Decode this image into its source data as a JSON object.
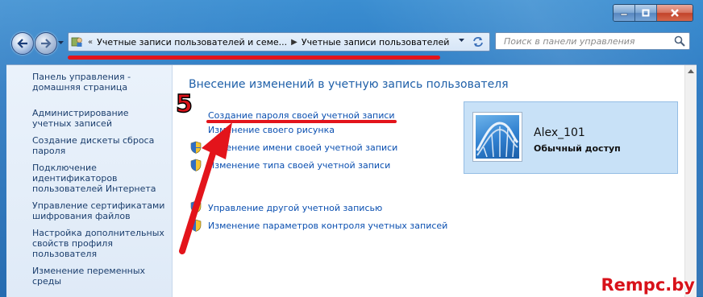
{
  "window": {
    "minimize_label": "minimize",
    "maximize_label": "maximize",
    "close_label": "close"
  },
  "address": {
    "overflow": "«",
    "crumb1": "Учетные записи пользователей и семе...",
    "crumb2": "Учетные записи пользователей"
  },
  "search": {
    "placeholder": "Поиск в панели управления"
  },
  "sidebar": {
    "items": [
      {
        "label": "Панель управления - домашняя страница"
      },
      {
        "label": "Администрирование учетных записей"
      },
      {
        "label": "Создание дискеты сброса пароля"
      },
      {
        "label": "Подключение идентификаторов пользователей Интернета"
      },
      {
        "label": "Управление сертификатами шифрования файлов"
      },
      {
        "label": "Настройка дополнительных свойств профиля пользователя"
      },
      {
        "label": "Изменение переменных среды"
      }
    ]
  },
  "main": {
    "title": "Внесение изменений в учетную запись пользователя",
    "tasks": [
      {
        "label": "Создание пароля своей учетной записи"
      },
      {
        "label": "Изменение своего рисунка"
      },
      {
        "label": "Изменение имени своей учетной записи"
      },
      {
        "label": "Изменение типа своей учетной записи"
      },
      {
        "label": "Управление другой учетной записью"
      },
      {
        "label": "Изменение параметров контроля учетных записей"
      }
    ]
  },
  "user": {
    "name": "Alex_101",
    "type": "Обычный доступ"
  },
  "annotation": {
    "step": "5",
    "watermark": "Rempc.by",
    "color": "#e3141b"
  }
}
